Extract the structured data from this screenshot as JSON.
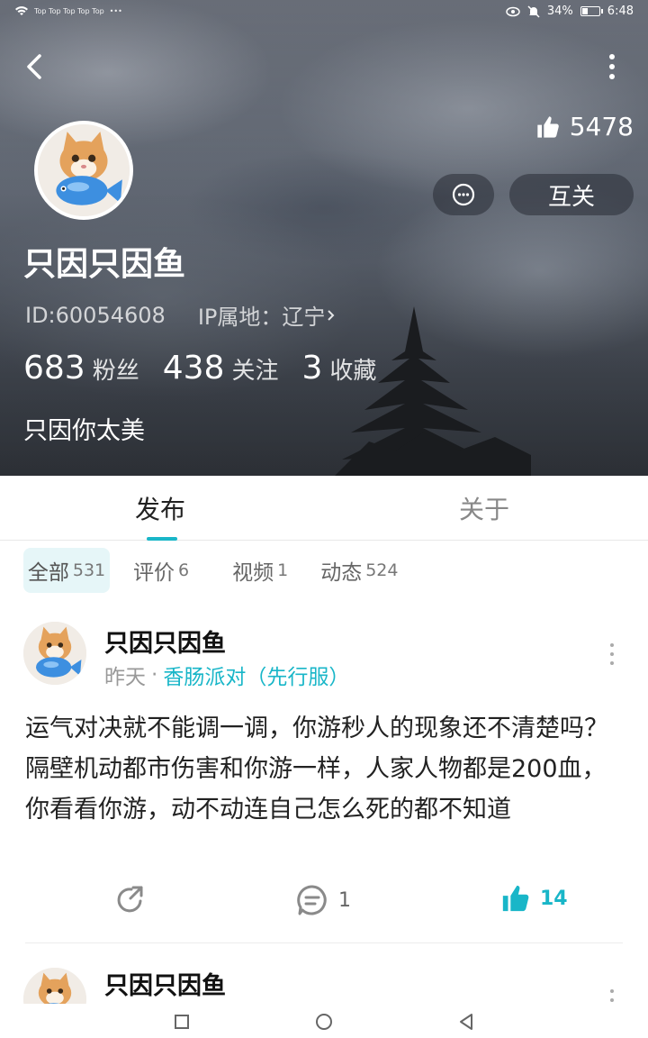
{
  "status_bar": {
    "carriers": "Top Top Top Top Top",
    "extra": "•••",
    "battery": "34%",
    "battery_level": 0.34,
    "time": "6:48"
  },
  "header": {
    "likes": "5478",
    "follow_label": "互关",
    "username": "只因只因鱼",
    "id_text": "ID:60054608",
    "ip_text": "IP属地：辽宁",
    "stats": [
      {
        "num": "683",
        "label": "粉丝"
      },
      {
        "num": "438",
        "label": "关注"
      },
      {
        "num": "3",
        "label": "收藏"
      }
    ],
    "bio": "只因你太美"
  },
  "tabs": [
    {
      "label": "发布",
      "active": true
    },
    {
      "label": "关于",
      "active": false
    }
  ],
  "filters": [
    {
      "label": "全部",
      "count": "531",
      "active": true
    },
    {
      "label": "评价",
      "count": "6"
    },
    {
      "label": "视频",
      "count": "1"
    },
    {
      "label": "动态",
      "count": "524"
    }
  ],
  "posts": [
    {
      "author": "只因只因鱼",
      "time": "昨天",
      "separator": "·",
      "game": "香肠派对（先行服）",
      "body": "运气对决就不能调一调，你游秒人的现象还不清楚吗？隔壁机动都市伤害和你游一样，人家人物都是200血，你看看你游，动不动连自己怎么死的都不知道",
      "comments": "1",
      "likes": "14"
    },
    {
      "author": "只因只因鱼"
    }
  ],
  "colors": {
    "accent": "#19b6c8",
    "chip_active_bg": "#e6f6f8"
  }
}
